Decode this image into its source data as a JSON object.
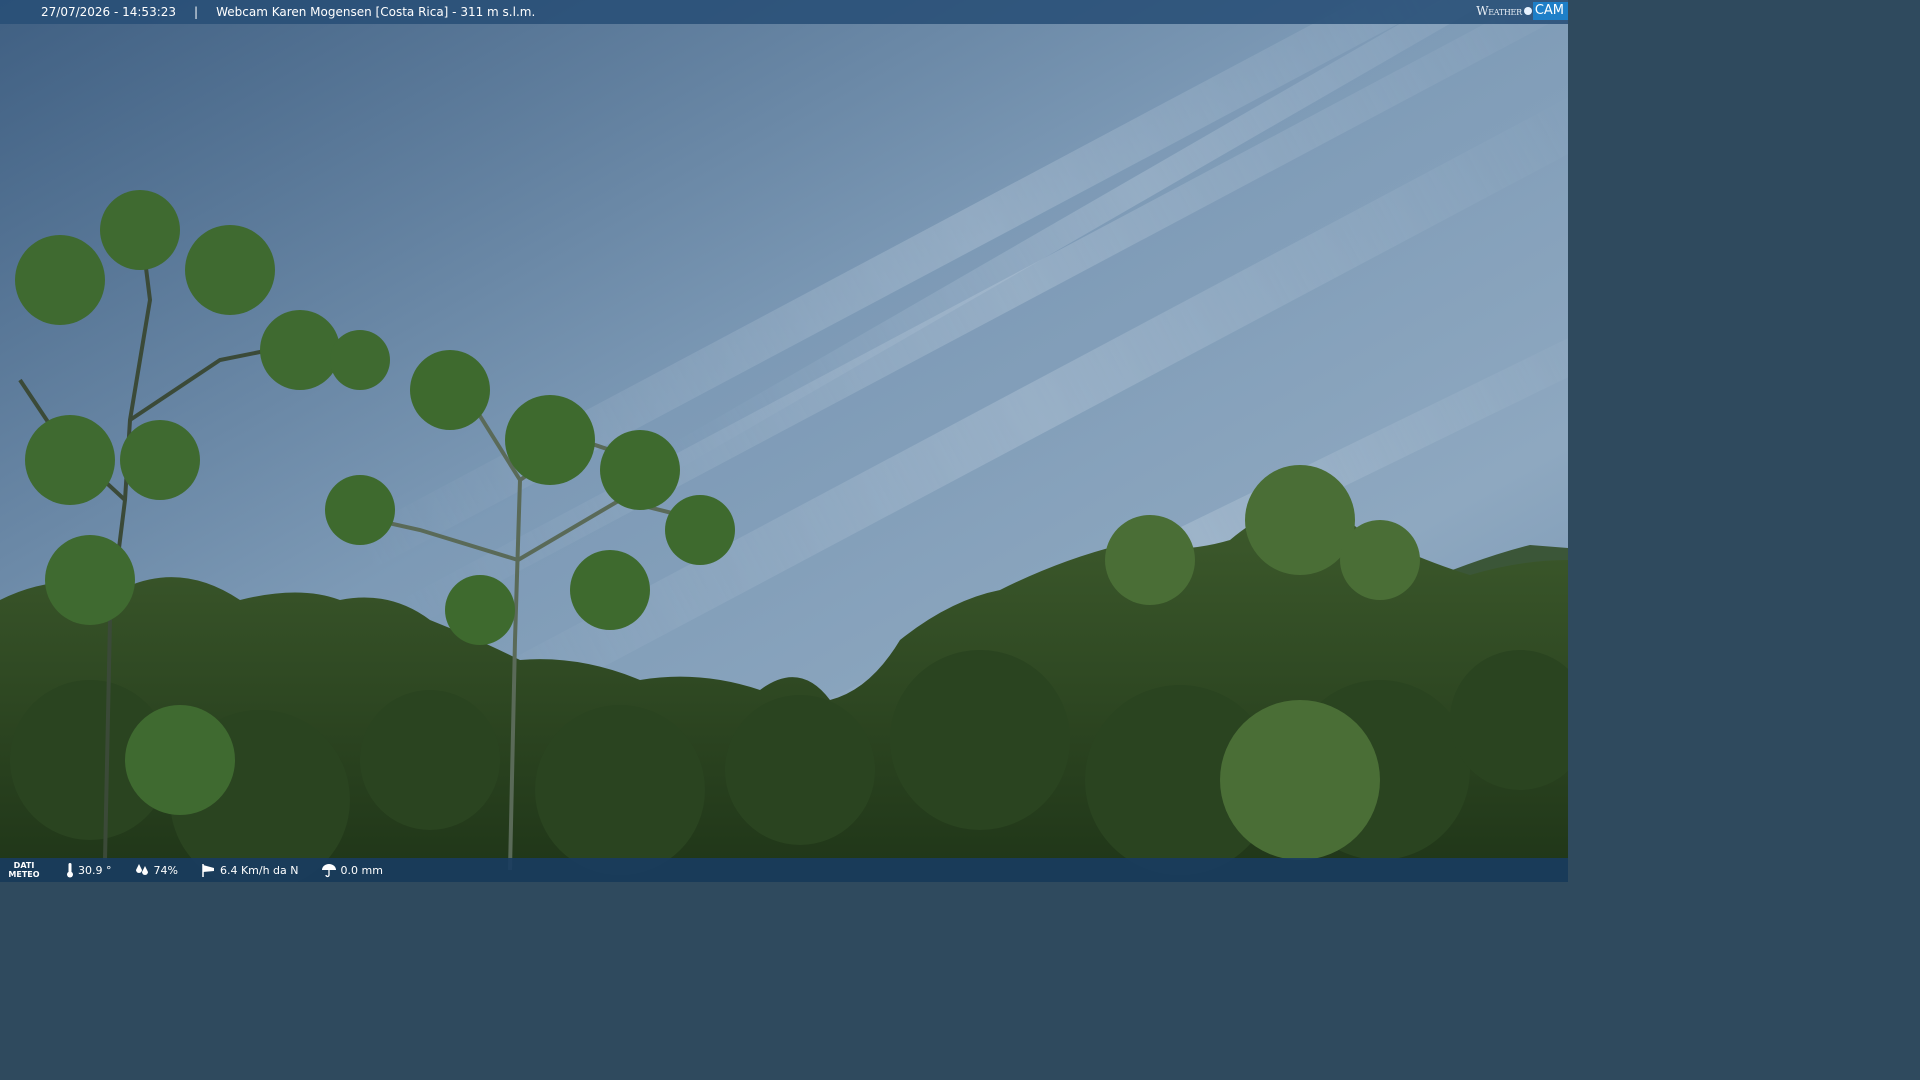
{
  "header": {
    "datetime": "27/07/2026 - 14:53:23",
    "separator": "|",
    "title": "Webcam Karen Mogensen [Costa Rica]  - 311 m s.l.m."
  },
  "logo": {
    "weather": "Weather",
    "cam": "CAM"
  },
  "footer": {
    "dati_line1": "DATI",
    "dati_line2": "METEO",
    "temperature": "30.9 °",
    "humidity": "74%",
    "wind": "6.4 Km/h da N",
    "rain": "0.0 mm"
  },
  "icons": {
    "temperature": "thermometer-icon",
    "humidity": "drops-icon",
    "wind": "windsock-icon",
    "rain": "umbrella-icon"
  },
  "colors": {
    "top_bar": "#284e76",
    "bottom_bar": "#183c60",
    "logo_cam": "#1e7fc8",
    "sky": "#7d9ab6",
    "foliage": "#2e4a22"
  }
}
